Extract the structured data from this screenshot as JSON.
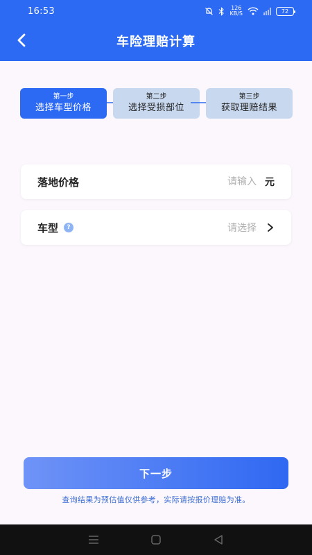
{
  "status_bar": {
    "time": "16:53",
    "network_speed_value": "126",
    "network_speed_unit": "KB/S",
    "battery": "72"
  },
  "header": {
    "title": "车险理赔计算",
    "back_icon": "chevron-left-icon"
  },
  "steps": [
    {
      "number": "第一步",
      "label": "选择车型价格",
      "active": true
    },
    {
      "number": "第二步",
      "label": "选择受损部位",
      "active": false
    },
    {
      "number": "第三步",
      "label": "获取理赔结果",
      "active": false
    }
  ],
  "form": {
    "price": {
      "label": "落地价格",
      "placeholder": "请输入",
      "unit": "元"
    },
    "car_model": {
      "label": "车型",
      "help_icon": "question-icon",
      "placeholder": "请选择",
      "chevron_icon": "chevron-right-icon"
    }
  },
  "footer": {
    "next_label": "下一步",
    "disclaimer": "查询结果为预估值仅供参考，实际请按报价理赔为准。"
  },
  "colors": {
    "primary": "#2d6af3",
    "step_inactive": "#c8d8ee",
    "background": "#fbf7fd"
  }
}
